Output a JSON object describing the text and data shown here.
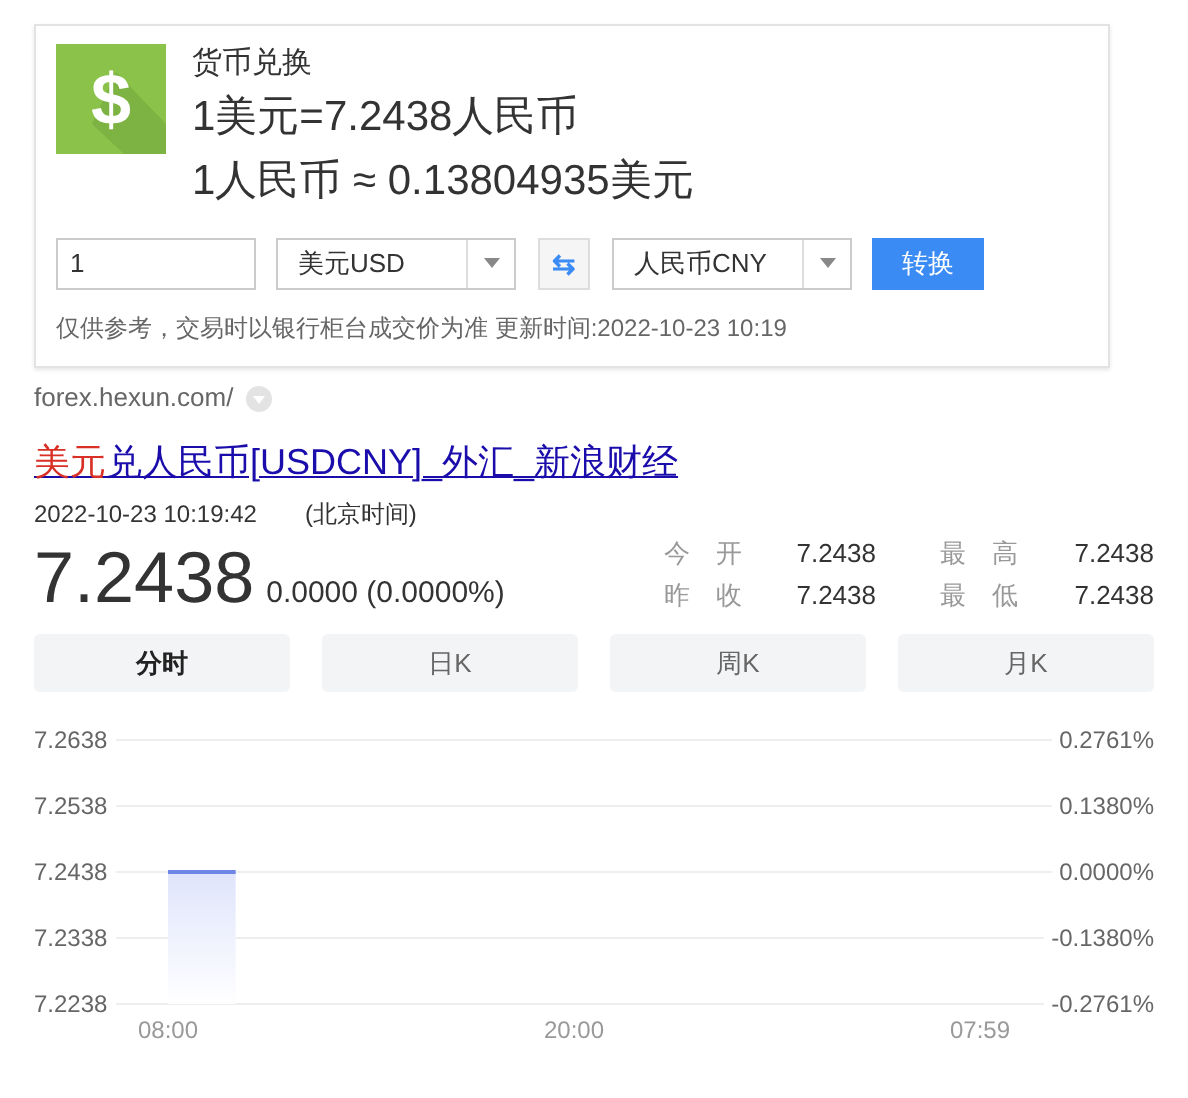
{
  "converter": {
    "icon_symbol": "$",
    "title": "货币兑换",
    "rate_line": "1美元=7.2438人民币",
    "inverse_line": "1人民币 ≈ 0.13804935美元",
    "amount": "1",
    "from_currency": "美元USD",
    "swap_icon": "⇆",
    "to_currency": "人民币CNY",
    "convert_button": "转换",
    "note": "仅供参考，交易时以银行柜台成交价为准 更新时间:2022-10-23 10:19"
  },
  "source_url": "forex.hexun.com/",
  "result": {
    "title_highlight": "美元",
    "title_rest": "兑人民币[USDCNY]_外汇_新浪财经",
    "timestamp": "2022-10-23 10:19:42",
    "timezone": "(北京时间)",
    "price": "7.2438",
    "change": "0.0000 (0.0000%)",
    "stats": [
      {
        "label": "今　开",
        "value": "7.2438"
      },
      {
        "label": "最　高",
        "value": "7.2438"
      },
      {
        "label": "昨　收",
        "value": "7.2438"
      },
      {
        "label": "最　低",
        "value": "7.2438"
      }
    ],
    "tabs": [
      {
        "label": "分时",
        "selected": true
      },
      {
        "label": "日K",
        "selected": false
      },
      {
        "label": "周K",
        "selected": false
      },
      {
        "label": "月K",
        "selected": false
      }
    ],
    "right_axis_labels": [
      "0.2761%",
      "0.1380%",
      "0.0000%",
      "-0.1380%",
      "-0.2761%"
    ],
    "chart_data": {
      "type": "area",
      "grid": true,
      "ylim": [
        7.2238,
        7.2638
      ],
      "categories": [
        "08:00",
        null,
        null,
        null,
        null,
        null,
        "20:00",
        null,
        null,
        null,
        null,
        null,
        "07:59"
      ],
      "yticks": [
        {
          "value": 7.2638,
          "label": "7.2638"
        },
        {
          "value": 7.2538,
          "label": "7.2538"
        },
        {
          "value": 7.2438,
          "label": "7.2438"
        },
        {
          "value": 7.2338,
          "label": "7.2338"
        },
        {
          "value": 7.2238,
          "label": "7.2238"
        }
      ],
      "series": [
        {
          "color": "#6f86e6",
          "values": [
            7.2438,
            7.2438,
            null,
            null,
            null,
            null,
            null,
            null,
            null,
            null,
            null,
            null,
            null
          ]
        }
      ]
    }
  }
}
